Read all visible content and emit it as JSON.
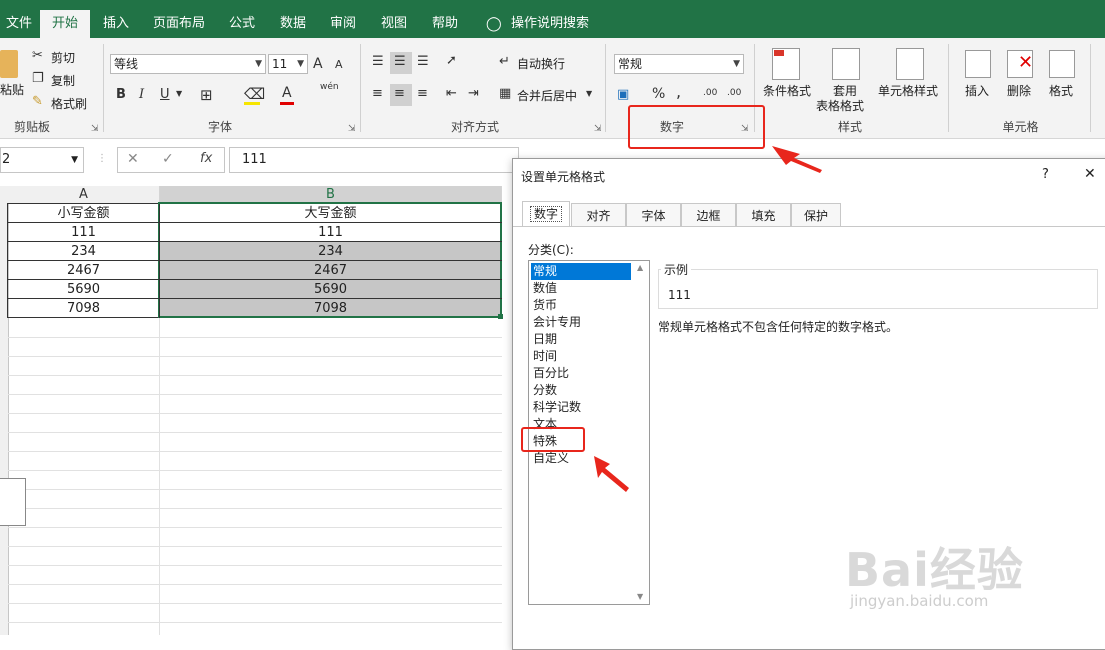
{
  "tabs": [
    {
      "label": "文件",
      "active": false
    },
    {
      "label": "开始",
      "active": true
    },
    {
      "label": "插入",
      "active": false
    },
    {
      "label": "页面布局",
      "active": false
    },
    {
      "label": "公式",
      "active": false
    },
    {
      "label": "数据",
      "active": false
    },
    {
      "label": "审阅",
      "active": false
    },
    {
      "label": "视图",
      "active": false
    },
    {
      "label": "帮助",
      "active": false
    }
  ],
  "tell_me": "操作说明搜索",
  "ribbon": {
    "clipboard": {
      "paste": "粘贴",
      "cut": "剪切",
      "copy": "复制",
      "format_painter": "格式刷",
      "label": "剪贴板"
    },
    "font": {
      "name": "等线",
      "size": "11",
      "grow": "A",
      "shrink": "A",
      "bold": "B",
      "italic": "I",
      "underline": "U",
      "label": "字体",
      "phonetic": "wén"
    },
    "align": {
      "wrap": "自动换行",
      "merge": "合并后居中",
      "label": "对齐方式"
    },
    "number": {
      "format": "常规",
      "percent": "%",
      "comma": ",",
      "label": "数字",
      "inc": ".00",
      "dec": ".00"
    },
    "styles": {
      "conditional": "条件格式",
      "table1": "套用",
      "table2": "表格格式",
      "cell_styles": "单元格样式",
      "label": "样式"
    },
    "cells": {
      "insert": "插入",
      "delete": "删除",
      "format": "格式",
      "label": "单元格"
    }
  },
  "formula_bar": {
    "name_box": "2",
    "fx": "fx",
    "value": "111"
  },
  "columns": {
    "a": "A",
    "b": "B"
  },
  "table": {
    "header_a": "小写金额",
    "header_b": "大写金额",
    "rows": [
      [
        "111",
        "111"
      ],
      [
        "234",
        "234"
      ],
      [
        "2467",
        "2467"
      ],
      [
        "5690",
        "5690"
      ],
      [
        "7098",
        "7098"
      ]
    ]
  },
  "dialog": {
    "title": "设置单元格格式",
    "help": "?",
    "close": "✕",
    "tabs": [
      "数字",
      "对齐",
      "字体",
      "边框",
      "填充",
      "保护"
    ],
    "category_label": "分类(C):",
    "categories": [
      "常规",
      "数值",
      "货币",
      "会计专用",
      "日期",
      "时间",
      "百分比",
      "分数",
      "科学记数",
      "文本",
      "特殊",
      "自定义"
    ],
    "selected_category": "常规",
    "sample_label": "示例",
    "sample_value": "111",
    "description": "常规单元格格式不包含任何特定的数字格式。"
  },
  "watermark": {
    "brand": "Bai经验",
    "url": "jingyan.baidu.com"
  },
  "colors": {
    "excel_green": "#217346",
    "select_blue": "#0078d7",
    "annotation_red": "#e8261c"
  }
}
